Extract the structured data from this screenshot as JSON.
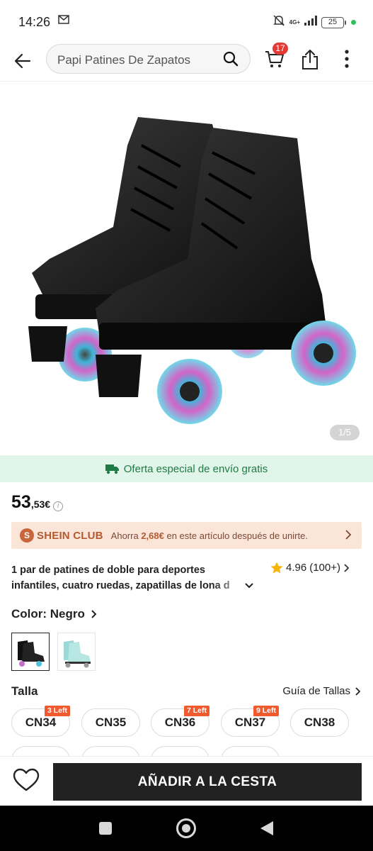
{
  "status_bar": {
    "time": "14:26",
    "network": "4G+",
    "battery": "25"
  },
  "header": {
    "search_text": "Papi Patines De Zapatos",
    "cart_count": "17"
  },
  "gallery": {
    "counter": "1/5"
  },
  "shipping": {
    "text": "Oferta especial de envío gratis"
  },
  "price": {
    "integer": "53",
    "decimal": ",53€"
  },
  "club": {
    "logo_letter": "S",
    "name": "SHEIN CLUB",
    "msg_prefix": "Ahorra ",
    "msg_amount": "2,68€",
    "msg_suffix": " en este artículo después de unirte."
  },
  "product": {
    "title_line1": "1 par de patines de doble  para deportes",
    "title_line2": "infantiles, cuatro ruedas, zapatillas de lona d",
    "rating": "4.96",
    "review_count": "(100+)"
  },
  "color": {
    "label": "Color: Negro"
  },
  "size": {
    "title": "Talla",
    "guide": "Guía de Tallas",
    "options": [
      {
        "label": "CN34",
        "tag": "3 Left"
      },
      {
        "label": "CN35",
        "tag": ""
      },
      {
        "label": "CN36",
        "tag": "7 Left"
      },
      {
        "label": "CN37",
        "tag": "9 Left"
      },
      {
        "label": "CN38",
        "tag": ""
      }
    ]
  },
  "actions": {
    "add_to_cart": "AÑADIR A LA CESTA"
  },
  "colors": {
    "shipping_green": "#1f7a45",
    "club_orange": "#b35a30",
    "badge_red": "#e53935",
    "tag_orange": "#f05a2f"
  }
}
